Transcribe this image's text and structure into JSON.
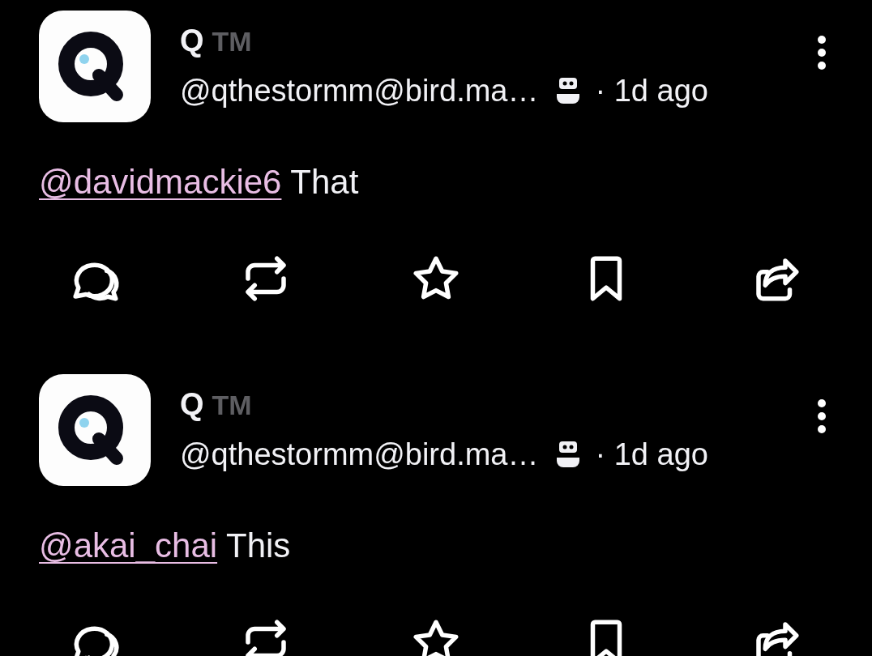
{
  "posts": [
    {
      "display_name": "Q",
      "badge": "TM",
      "handle": "@qthestormm@bird.ma…",
      "bot": true,
      "time": "· 1d ago",
      "mention": "@davidmackie6",
      "text": "That"
    },
    {
      "display_name": "Q",
      "badge": "TM",
      "handle": "@qthestormm@bird.ma…",
      "bot": true,
      "time": "· 1d ago",
      "mention": "@akai_chai",
      "text": "This"
    }
  ]
}
